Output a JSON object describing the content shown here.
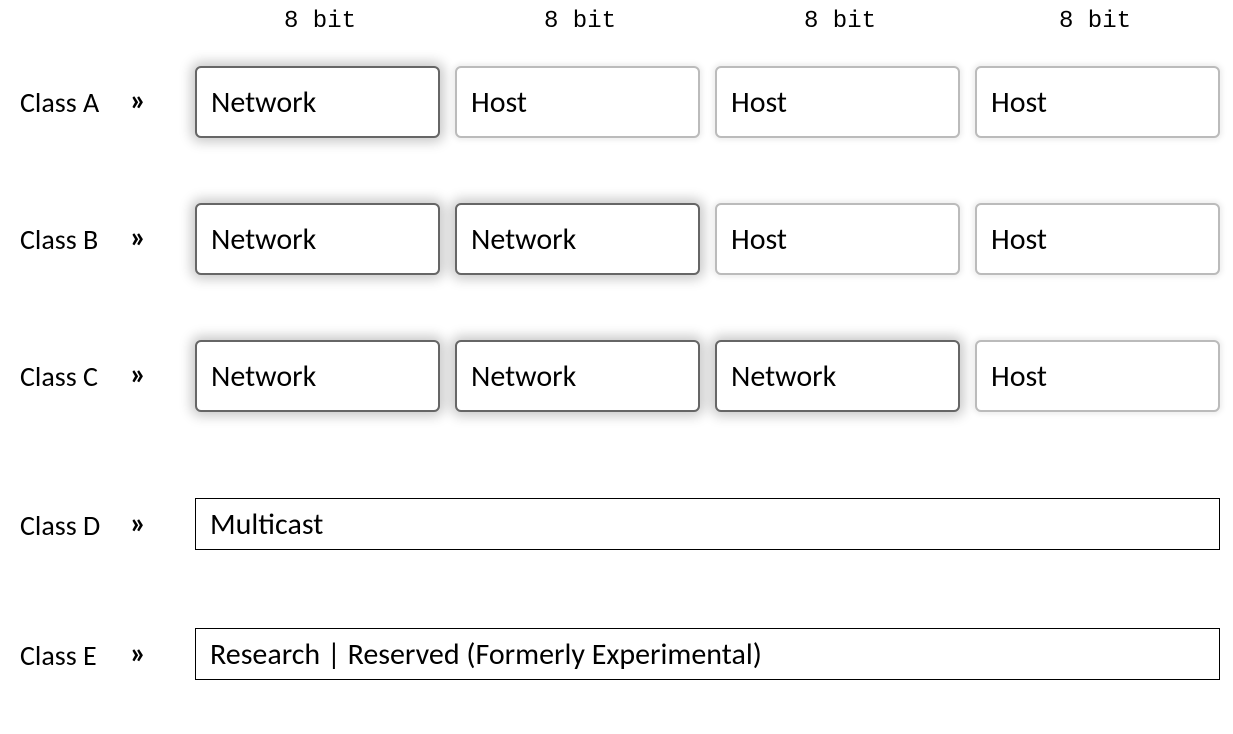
{
  "headers": {
    "col0": "8 bit",
    "col1": "8 bit",
    "col2": "8 bit",
    "col3": "8 bit"
  },
  "rows": {
    "a": {
      "label": "Class A",
      "marker": "»",
      "octets": {
        "c0": "Network",
        "c1": "Host",
        "c2": "Host",
        "c3": "Host"
      }
    },
    "b": {
      "label": "Class B",
      "marker": "»",
      "octets": {
        "c0": "Network",
        "c1": "Network",
        "c2": "Host",
        "c3": "Host"
      }
    },
    "c": {
      "label": "Class C",
      "marker": "»",
      "octets": {
        "c0": "Network",
        "c1": "Network",
        "c2": "Network",
        "c3": "Host"
      }
    },
    "d": {
      "label": "Class D",
      "marker": "»",
      "text": "Multicast"
    },
    "e": {
      "label": "Class E",
      "marker": "»",
      "text": "Research | Reserved (Formerly Experimental)"
    }
  }
}
